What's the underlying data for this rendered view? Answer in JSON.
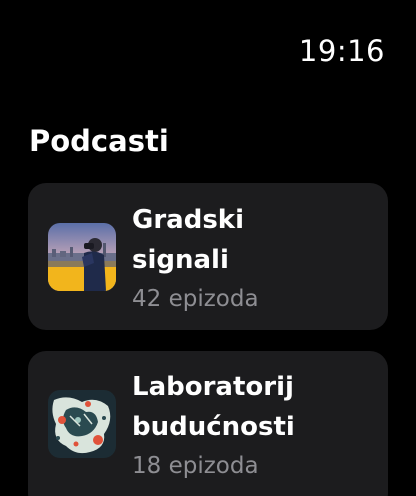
{
  "status_bar": {
    "time": "19:16"
  },
  "header": {
    "title": "Podcasti"
  },
  "podcasts": [
    {
      "title": "Gradski signali",
      "episodes": "42 epizoda",
      "artwork_icon": "city-night-photographer-artwork"
    },
    {
      "title": "Laboratorij budućnosti",
      "episodes": "18 epizoda",
      "artwork_icon": "abstract-science-artwork"
    }
  ],
  "colors": {
    "background": "#000000",
    "card": "#1c1c1e",
    "secondary_text": "#8e8e93"
  }
}
